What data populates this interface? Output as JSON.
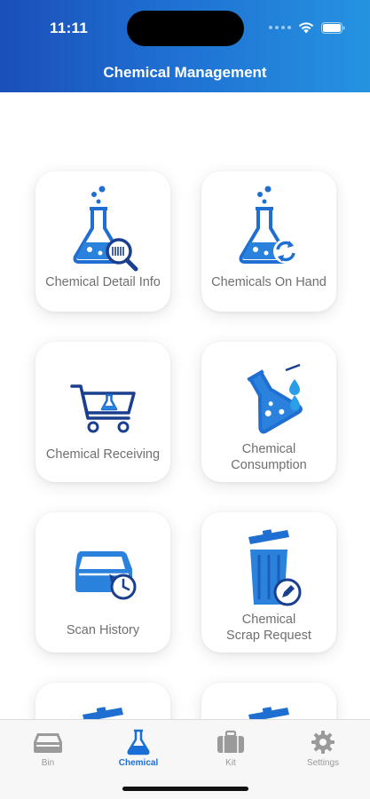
{
  "status_bar": {
    "time": "11:11",
    "wifi_icon": "wifi-icon",
    "battery_icon": "battery-icon"
  },
  "header": {
    "title": "Chemical Management"
  },
  "colors": {
    "primary": "#1f6fd2",
    "header_left": "#1a4fb8",
    "header_right": "#2593e0",
    "inactive_tab": "#9a9a9a"
  },
  "tiles": [
    {
      "label": "Chemical Detail Info",
      "icon": "flask-search-icon"
    },
    {
      "label": "Chemicals On Hand",
      "icon": "flask-refresh-icon"
    },
    {
      "label": "Chemical Receiving",
      "icon": "cart-flask-icon"
    },
    {
      "label": "Chemical\nConsumption",
      "icon": "flask-drip-icon"
    },
    {
      "label": "Scan History",
      "icon": "scanner-history-icon"
    },
    {
      "label": "Chemical\nScrap Request",
      "icon": "trash-edit-icon"
    },
    {
      "label": "",
      "icon": "partial-tile-icon"
    },
    {
      "label": "",
      "icon": "partial-tile-icon"
    }
  ],
  "tabbar": {
    "items": [
      {
        "label": "Bin",
        "icon": "bin-tray-icon",
        "active": false
      },
      {
        "label": "Chemical",
        "icon": "flask-icon",
        "active": true
      },
      {
        "label": "Kit",
        "icon": "briefcase-icon",
        "active": false
      },
      {
        "label": "Settings",
        "icon": "gear-icon",
        "active": false
      }
    ]
  }
}
